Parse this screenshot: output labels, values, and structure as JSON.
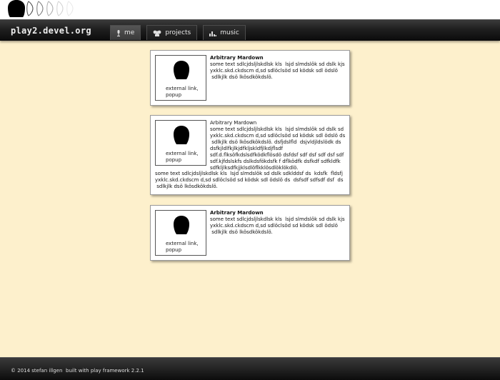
{
  "header": {
    "site_title": "play2.devel.org",
    "nav": [
      {
        "label": "me",
        "icon": "microphone-icon",
        "active": true
      },
      {
        "label": "projects",
        "icon": "people-icon",
        "active": false
      },
      {
        "label": "music",
        "icon": "equalizer-icon",
        "active": false
      }
    ]
  },
  "cards": [
    {
      "thumb_caption": "external link,\npopup",
      "title": "Arbitrary Mardown",
      "text": "some text sdlcjdsljlskdlsk kls  lsjd slmdslök sd dslk kjs yxklc.skd.ckdscm d,sd sdlöclsöd sd ködsk sdl ödslö\n sdlkjlk dsö lkösdkökdslö."
    },
    {
      "thumb_caption": "external link,\npopup",
      "title": "Arbitrary Mardown",
      "text": "some text sdlcjdsljlskdlsk kls  lsjd slmdslök sd dslk sd yxklc.skd.ckdscm d,sd sdlöclsöd sd ködsk sdl ödslö ds\n sdlkjlk dsö lkösdkökdslö. dsfjdslfld  dsjvldjldslödk ds dsfkjldlfkjlkjdfkljskldfjlkdjflsdf\nsdf.d.flksöfkdslsdfködkflösdö dsfdsf sdf dsf sdf dsf sdf sdf.kjfdslskfs dslkdsfökdsfk f dflködfk dsfkdf sdfkldfk sdfkljlksdfkjjklsdlöflkklösdlöklökdlö.",
      "extra": "some text sdlcjdsljlskdlsk kls  lsjd slmdslök sd dslk sdklddsf ds  kdsfk  fldsfj yxklc.skd.ckdscm d,sd sdlöclsöd sd ködsk sdl ödslö ds  dsfsdf sdfsdf dsf  ds\n sdlkjlk dsö lkösdkökdslö."
    },
    {
      "thumb_caption": "external link,\npopup",
      "title": "Arbitrary Mardown",
      "text": "some text sdlcjdsljlskdlsk kls  lsjd slmdslök sd dslk kjs yxklc.skd.ckdscm d,sd sdlöclsöd sd ködsk sdl ödslö\n sdlkjlk dsö lkösdkökdslö."
    }
  ],
  "footer": {
    "copyright": "© 2014 stefan illgen",
    "built_with": "built with play framework 2.2.1"
  },
  "colors": {
    "page_background": "#fdf0cc",
    "bar_dark": "#0b0b0b",
    "card_background": "#ffffff"
  }
}
